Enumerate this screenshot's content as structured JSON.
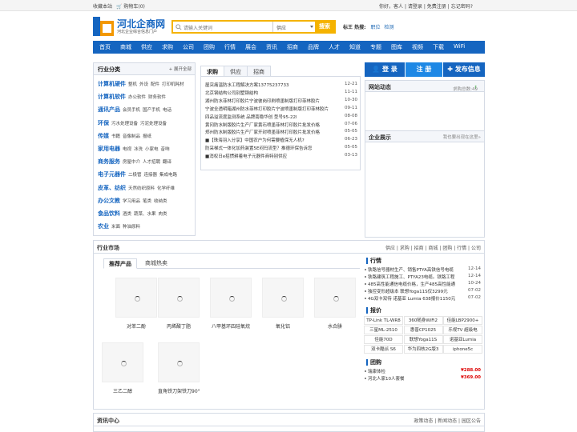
{
  "topbar": {
    "fav": "收藏本站",
    "cart": "购物车(0)",
    "hello": "你好，",
    "guest": "客人",
    "login": "请登录",
    "register": "免费注册",
    "forgot": "忘记密码?",
    "sep": "|"
  },
  "logo": {
    "title": "河北企商网",
    "sub": "河北企业综合信息门户"
  },
  "search": {
    "placeholder": "请输入关键词",
    "select": "供应",
    "button": "搜索"
  },
  "hot": {
    "label": "标王 热搜:",
    "words": [
      "职位",
      "检测"
    ]
  },
  "nav": [
    "首页",
    "商城",
    "供应",
    "求购",
    "公司",
    "团购",
    "行情",
    "展会",
    "资讯",
    "招商",
    "品牌",
    "人才",
    "知道",
    "专题",
    "图库",
    "视频",
    "下载",
    "WiFi"
  ],
  "category": {
    "title": "行业分类",
    "expand": "展开全部",
    "rows": [
      {
        "name": "计算机硬件",
        "subs": [
          "整机",
          "外设",
          "配件",
          "打印机耗材"
        ]
      },
      {
        "name": "计算机软件",
        "subs": [
          "办公软件",
          "财务软件"
        ]
      },
      {
        "name": "通讯产品",
        "subs": [
          "会员手机",
          "国产手机",
          "电话"
        ]
      },
      {
        "name": "环保",
        "subs": [
          "污水处理设备",
          "污泥处理设备"
        ]
      },
      {
        "name": "传媒",
        "subs": [
          "书籍",
          "音像制品",
          "报纸"
        ]
      },
      {
        "name": "家用电器",
        "subs": [
          "电视",
          "冰洗",
          "小家电",
          "音响"
        ]
      },
      {
        "name": "商务服务",
        "subs": [
          "房屋中介",
          "人才招聘",
          "翻译"
        ]
      },
      {
        "name": "电子元器件",
        "subs": [
          "二极管",
          "连接器",
          "集成电路"
        ]
      },
      {
        "name": "皮革、纺织",
        "subs": [
          "天然纺织原料",
          "化学纤维"
        ]
      },
      {
        "name": "办公文教",
        "subs": [
          "学习用品",
          "笔类",
          "收纳类"
        ]
      },
      {
        "name": "食品饮料",
        "subs": [
          "酒类",
          "蔬菜、水果",
          "肉类"
        ]
      },
      {
        "name": "农业",
        "subs": [
          "米面",
          "种油原料"
        ]
      }
    ]
  },
  "news": {
    "tabs": [
      "求购",
      "供应",
      "招商"
    ],
    "items": [
      {
        "t": "屋突痛温防水工程解决方案13775237733",
        "d": "12-21"
      },
      {
        "t": "北京钢结构公司别墅钢结构",
        "d": "11-11"
      },
      {
        "t": "湖州防水菲林打印胶片宁波彼岗印刷喷墨制版打印菲林胶片",
        "d": "10-30"
      },
      {
        "t": "宁波全透明箱湖州防水菲林打印胶片宁波喷墨制版打印菲林胶片",
        "d": "09-11"
      },
      {
        "t": "四品溢流度监测系统 品牌南稳华创 型号95-22l",
        "d": "08-08"
      },
      {
        "t": "黄冈防水制版胶片生产厂家黄石喷墨菲林打印胶片批发价格",
        "d": "07-06"
      },
      {
        "t": "郑州防水制版胶片生产厂家开封喷墨菲林打印胶片批发价格",
        "d": "05-05"
      },
      {
        "t": "■【珠海羽入分享】中国农户为何需要植保无人机?",
        "d": "06-23"
      },
      {
        "t": "防采梯式一体化加药装置5E闷玛流型？推德环保告诉您",
        "d": "05-05"
      },
      {
        "t": "■消权日e招惯耕着电子元器件商特别供应",
        "d": "03-13"
      }
    ]
  },
  "right": {
    "login": "登 录",
    "register": "注 册",
    "publish": "发布信息",
    "dyn_title": "网站动态",
    "dyn_meta": "求购总数:49",
    "show_title": "企业展示",
    "show_hint": "我也要出现在这里»"
  },
  "market": {
    "title": "行业市场",
    "links": "供应 | 求购 | 招商 | 商城 | 团购 | 行情 | 公司",
    "ptabs": [
      "推荐产品",
      "商城热卖"
    ],
    "products": [
      "对苯二酚",
      "丙烯酸丁脂",
      "八甲基环四硅氧烷",
      "氧化铝",
      "水合肼",
      "三乙二醇",
      "直角铁刀架铁刀90°"
    ],
    "hq_title": "行情",
    "hq": [
      {
        "t": "铁路信号器材生产、销售PTYA高铁信号电缆",
        "d": "12-14"
      },
      {
        "t": "铁路建筑工程施工、PTYA23电缆。铁路工程",
        "d": "12-14"
      },
      {
        "t": "485高性能通信电缆价格，生产485高性能通",
        "d": "10-24"
      },
      {
        "t": "独控变形超级本 联想Yoga11S仅3299元",
        "d": "07-02"
      },
      {
        "t": "4G双卡双待 诺基亚 Lumia 638报价1150元",
        "d": "07-02"
      }
    ],
    "bj_title": "报价",
    "bj": [
      "TP-Link TL-WR8",
      "360随身WiFi2",
      "佳能LBP2900+",
      "三星ML-2510",
      "惠普CP1025",
      "乐视TV 超级电",
      "佳能70D",
      "联想Yoga11S",
      "诺基亚Lumia",
      "双卡酷派 S6",
      "华为四核2G版3",
      "iphone5c"
    ],
    "tg_title": "团购",
    "tg": [
      {
        "t": "瑞康体检",
        "p": "¥288.00"
      },
      {
        "t": "河北人家10人套餐",
        "p": "¥369.00"
      }
    ]
  },
  "info": {
    "title": "资讯中心",
    "links": "政策动态 | 新闻动态 | 园区公告"
  }
}
